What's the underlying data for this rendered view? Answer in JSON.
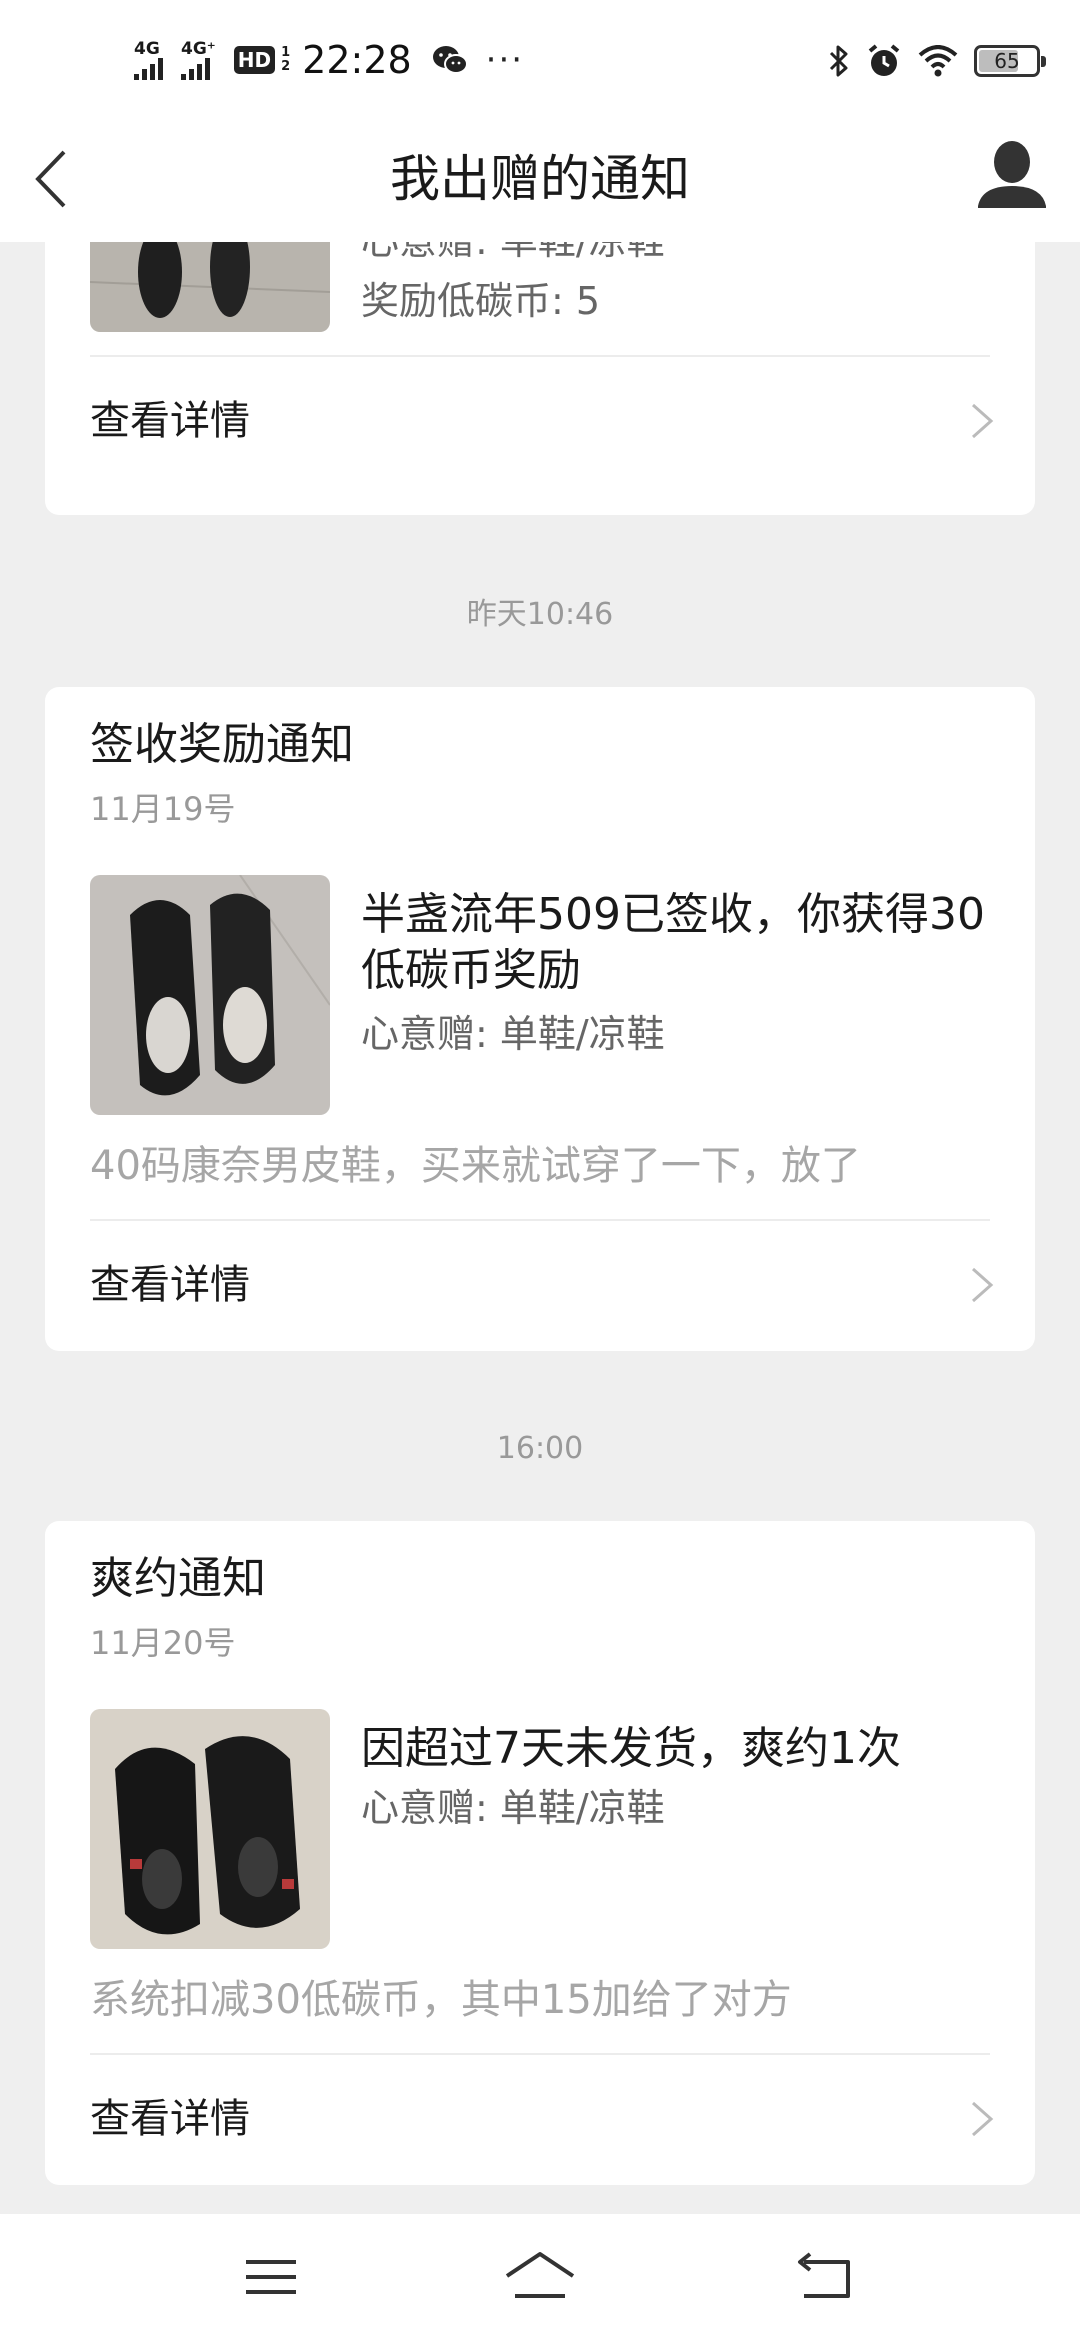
{
  "status_bar": {
    "signal_1": "4G",
    "signal_2": "4G⁺",
    "hd_label": "HD",
    "hd_sub_1": "1",
    "hd_sub_2": "2",
    "time": "22:28",
    "more": "···",
    "battery_level": "65",
    "battery_fraction": 0.65,
    "icons": [
      "signal-icon",
      "hd-icon",
      "wechat-icon",
      "more-icon",
      "bluetooth-icon",
      "alarm-icon",
      "wifi-icon",
      "battery-icon"
    ]
  },
  "header": {
    "title": "我出赠的通知",
    "back_icon": "chevron-left-icon",
    "profile_icon": "user-icon"
  },
  "cards": [
    {
      "gift": "心意赠: 单鞋/凉鞋",
      "reward": "奖励低碳币: 5",
      "detail": "查看详情"
    },
    {
      "time": "昨天10:46",
      "title": "签收奖励通知",
      "date": "11月19号",
      "message": "半盏流年509已签收，你获得30低碳币奖励",
      "gift": "心意赠: 单鞋/凉鞋",
      "description": "40码康奈男皮鞋，买来就试穿了一下，放了",
      "detail": "查看详情"
    },
    {
      "time": "16:00",
      "title": "爽约通知",
      "date": "11月20号",
      "message": "因超过7天未发货，爽约1次",
      "gift": "心意赠: 单鞋/凉鞋",
      "description": "系统扣减30低碳币，其中15加给了对方",
      "detail": "查看详情"
    }
  ],
  "nav_bar": {
    "icons": [
      "menu-icon",
      "home-icon",
      "back-icon"
    ]
  }
}
